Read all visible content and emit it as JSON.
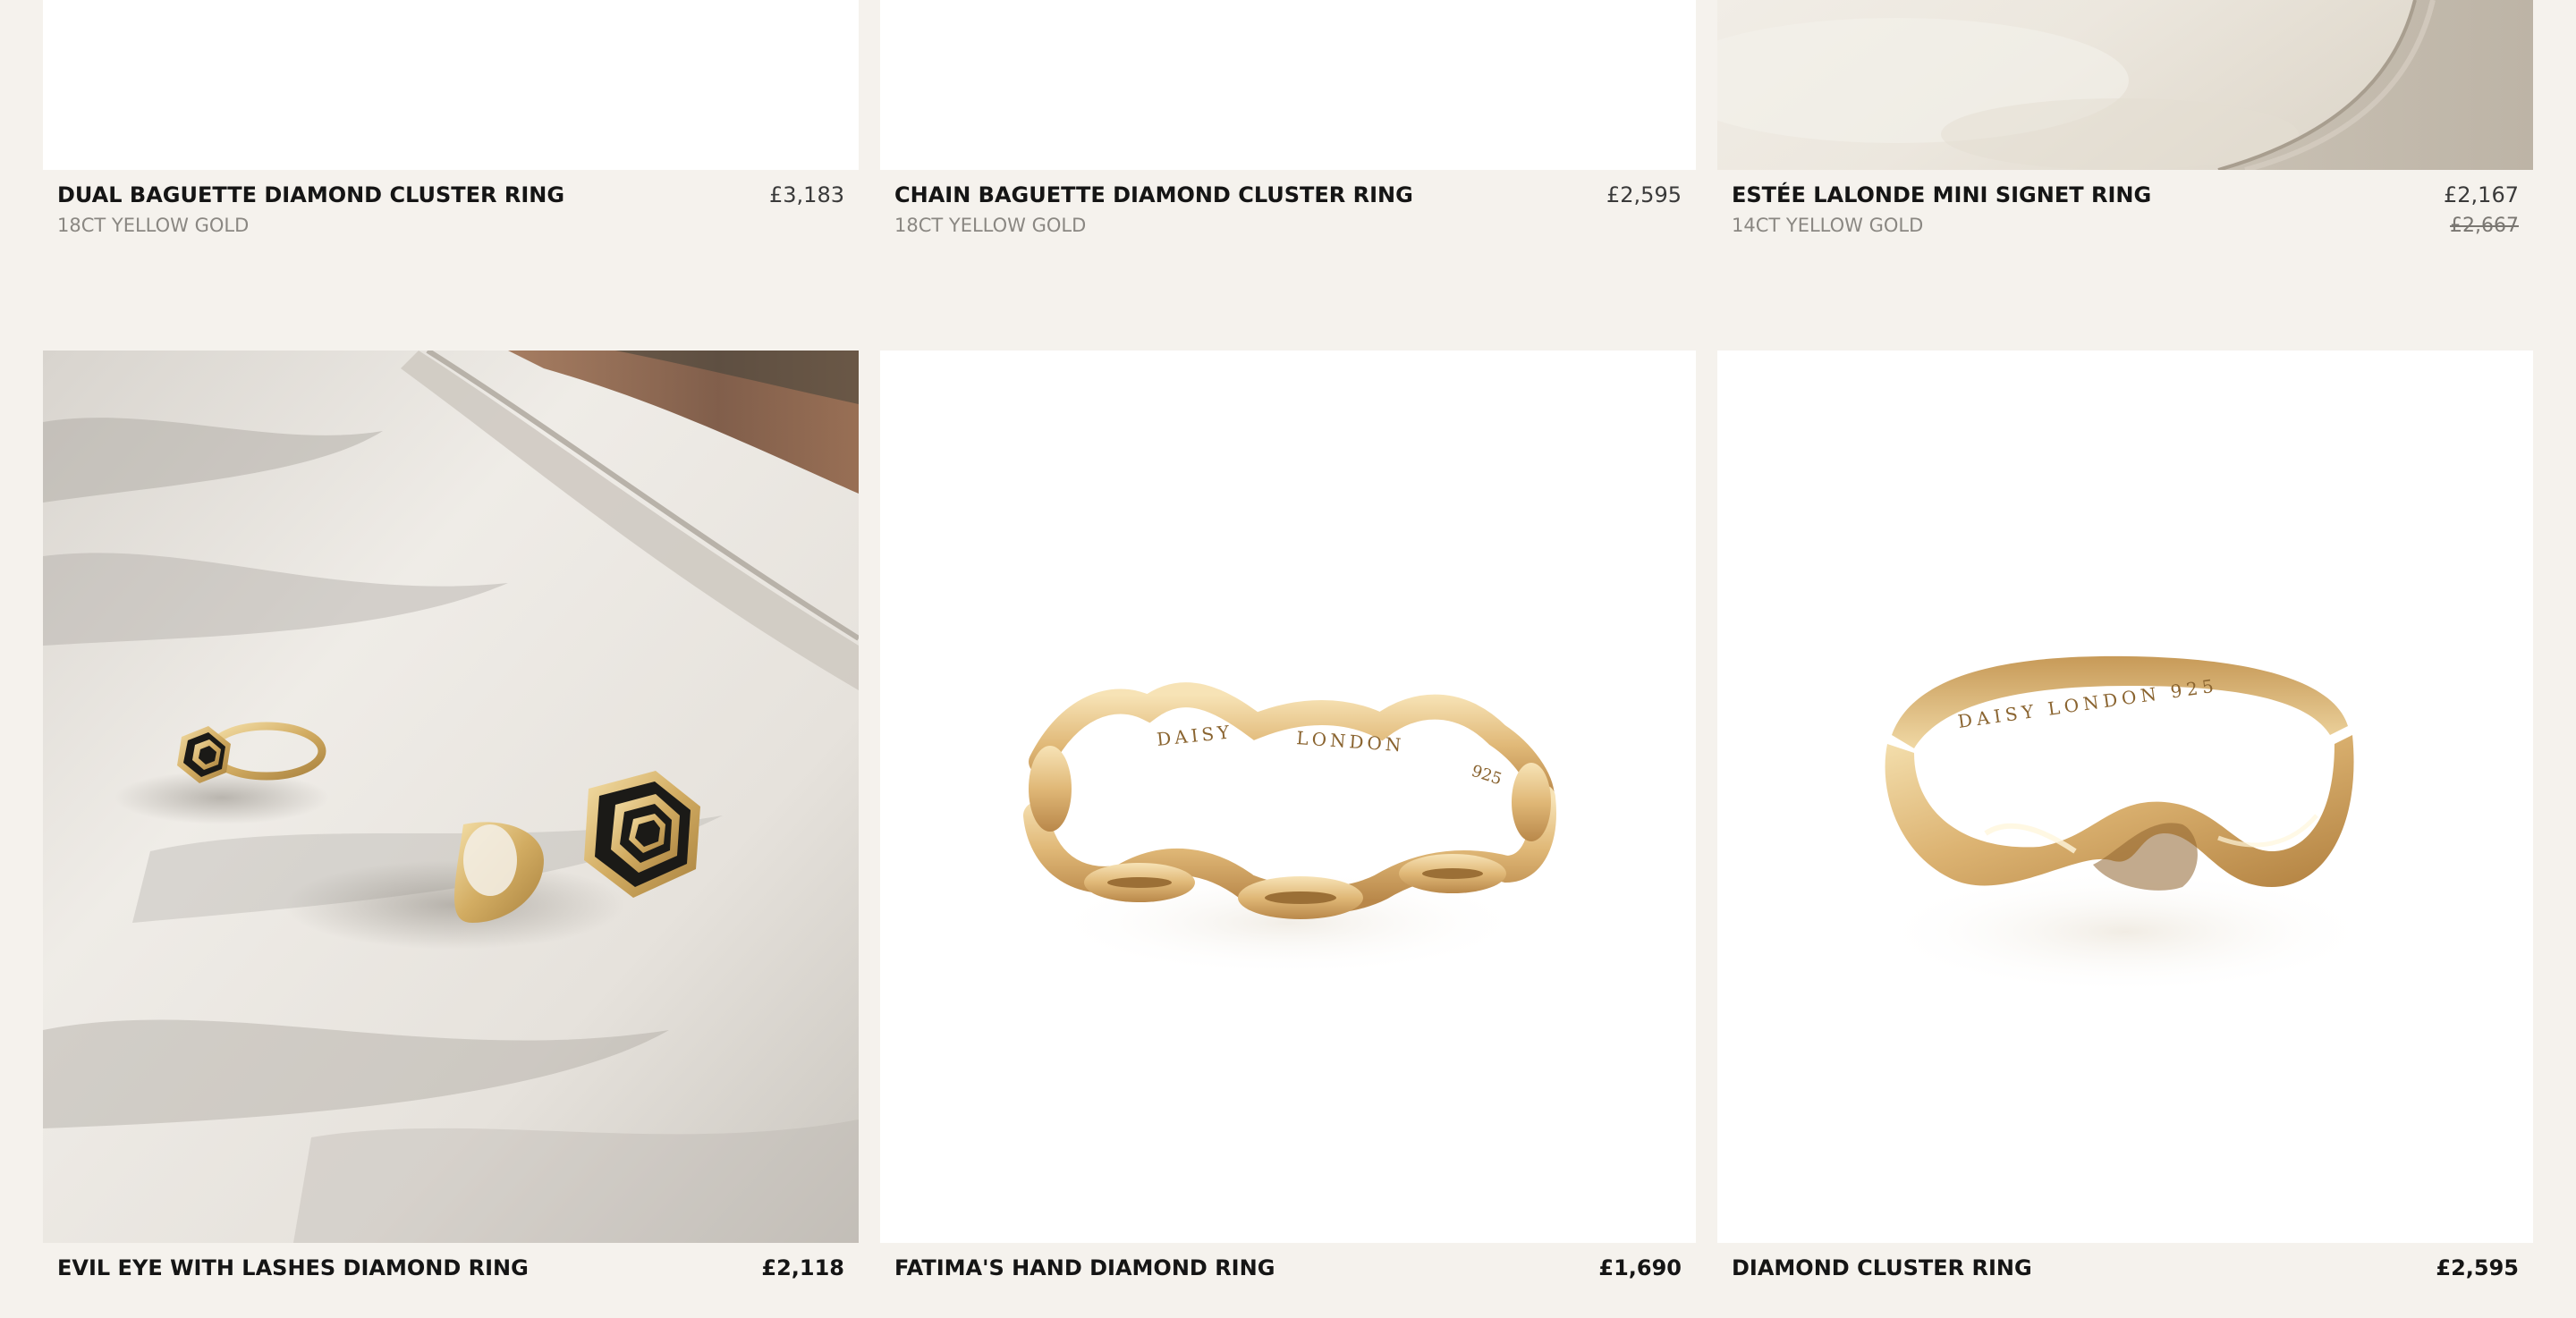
{
  "products_row1": [
    {
      "name": "DUAL BAGUETTE DIAMOND CLUSTER RING",
      "material": "18CT YELLOW GOLD",
      "price": "£3,183"
    },
    {
      "name": "CHAIN BAGUETTE DIAMOND CLUSTER RING",
      "material": "18CT YELLOW GOLD",
      "price": "£2,595"
    },
    {
      "name": "ESTÉE LALONDE MINI SIGNET RING",
      "material": "14CT YELLOW GOLD",
      "price": "£2,167",
      "original_price": "£2,667"
    }
  ],
  "products_row2": [
    {
      "name": "EVIL EYE WITH LASHES DIAMOND RING",
      "price": "£2,118"
    },
    {
      "name": "FATIMA'S HAND DIAMOND RING",
      "price": "£1,690",
      "engraving": [
        "DAISY",
        "LONDON",
        "925"
      ]
    },
    {
      "name": "DIAMOND CLUSTER RING",
      "price": "£2,595",
      "engraving": "DAISY LONDON 925"
    }
  ]
}
